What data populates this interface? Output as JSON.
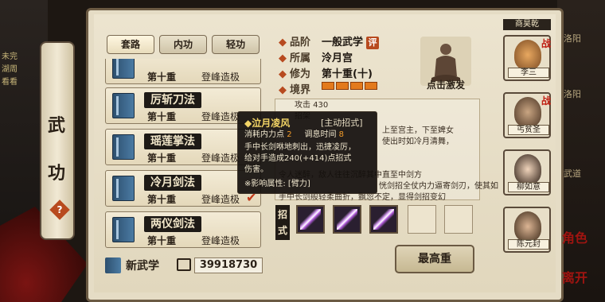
{
  "background": {
    "left_texts": [
      "未完",
      "湖周",
      "看看"
    ],
    "right_texts": [
      "洛阳",
      "洛阳",
      "武道"
    ]
  },
  "scroll": {
    "title_1": "武",
    "title_2": "功",
    "help": "?"
  },
  "tabs": [
    {
      "label": "套路"
    },
    {
      "label": "内功"
    },
    {
      "label": "轻功"
    }
  ],
  "skills": [
    {
      "name": "",
      "level": "第十重",
      "rank": "登峰造极"
    },
    {
      "name": "厉斩刀法",
      "level": "第十重",
      "rank": "登峰造极"
    },
    {
      "name": "瑶莲掌法",
      "level": "第十重",
      "rank": "登峰造极"
    },
    {
      "name": "冷月剑法",
      "level": "第十重",
      "rank": "登峰造极"
    },
    {
      "name": "两仪剑法",
      "level": "第十重",
      "rank": "登峰造极"
    }
  ],
  "footer": {
    "new_skill": "新武学",
    "money": "39918730"
  },
  "info": {
    "grade_label": "品阶",
    "grade_value": "一般武学",
    "grade_badge": "评",
    "sect_label": "所属",
    "sect_value": "泠月宫",
    "cultivation_label": "修为",
    "cultivation_value": "第十重(十)",
    "realm_label": "境界",
    "realm_level": 1.0
  },
  "master": {
    "label": "点击激发"
  },
  "description": {
    "line1": "攻击  430",
    "line2": "招架",
    "line3": "上至宫主，下至婢女",
    "line4": "使出时如冷月清舞，",
    "line5": "令人迷醉，敌人往往沉醉其中直至中剑方",
    "line6": "恍剑招全仗内力逼寄剑刃，使其如",
    "line7": "手中长剑般轻柔曲折，飘忽不定，显得剑招变幻"
  },
  "tooltip": {
    "title": "◆泣月凌风",
    "type": "[主动招式]",
    "cost_label": "消耗内力点",
    "cost_value": "2",
    "cooldown_label": "调息时间",
    "cooldown_value": "8",
    "desc1": "手中长剑咻地刺出，迅捷凌厉，",
    "desc2": "给对手造成240(+414)点招式",
    "desc3": "伤害。",
    "attr": "※影响属性: [臂力]"
  },
  "moves": {
    "label_1": "招",
    "label_2": "式"
  },
  "max_button": "最高重",
  "characters": {
    "header": "商昊乾",
    "list": [
      {
        "name": "李三",
        "badge": "战"
      },
      {
        "name": "丐贫圣",
        "badge": "战"
      },
      {
        "name": "柳如意",
        "badge": ""
      },
      {
        "name": "陈元封",
        "badge": ""
      }
    ]
  },
  "side_buttons": {
    "role": "角色",
    "exit": "离开"
  },
  "colors": {
    "accent": "#b84a1e",
    "bar": "#e37a1c",
    "tooltip_title": "#f3d566"
  }
}
